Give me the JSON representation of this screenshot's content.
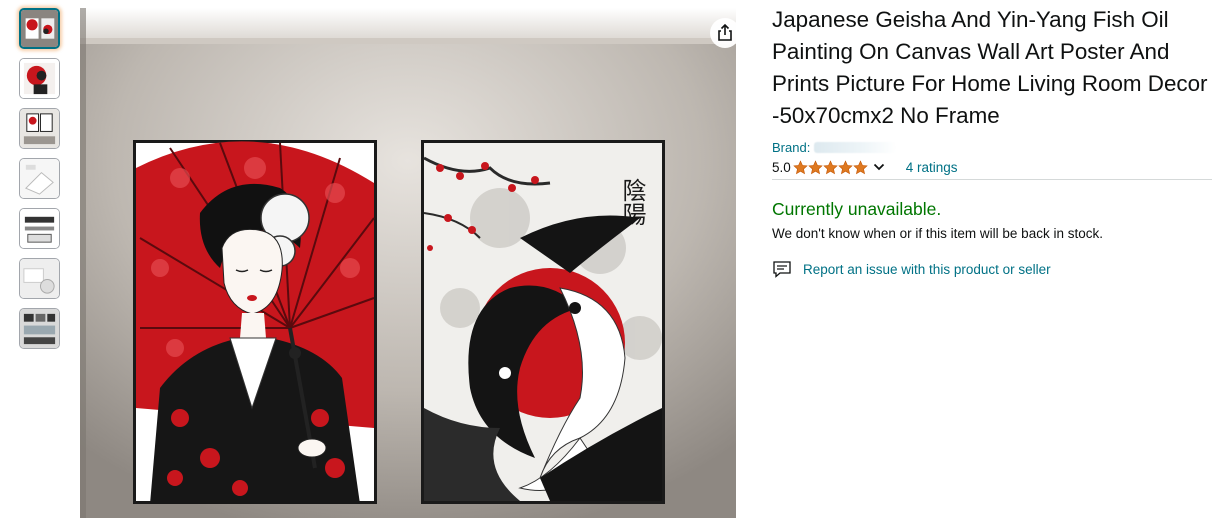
{
  "product": {
    "title": "Japanese Geisha And Yin-Yang Fish Oil Painting On Canvas Wall Art Poster And Prints Picture For Home Living Room Decor -50x70cmx2 No Frame",
    "brand_label": "Brand:",
    "rating_value": "5.0",
    "stars_filled": 5,
    "ratings_count_text": "4 ratings",
    "availability": "Currently unavailable.",
    "availability_note": "We don't know when or if this item will be back in stock.",
    "report_link": "Report an issue with this product or seller"
  },
  "thumbnails": [
    {
      "name": "geisha-koi-pair-thumb",
      "selected": true
    },
    {
      "name": "geisha-closeup-thumb",
      "selected": false
    },
    {
      "name": "room-scene-thumb",
      "selected": false
    },
    {
      "name": "canvas-corner-thumb",
      "selected": false
    },
    {
      "name": "frame-diagram-thumb",
      "selected": false
    },
    {
      "name": "canvas-rolls-thumb",
      "selected": false
    },
    {
      "name": "packaging-thumb",
      "selected": false
    }
  ],
  "painting_text": {
    "kanji": "陰陽"
  },
  "colors": {
    "link": "#007185",
    "available_green": "#007600",
    "star": "#de7921",
    "red": "#d0161d"
  },
  "icons": {
    "share": "share-icon",
    "report": "report-flag-icon",
    "chevron": "chevron-down-icon",
    "star": "star-icon"
  }
}
